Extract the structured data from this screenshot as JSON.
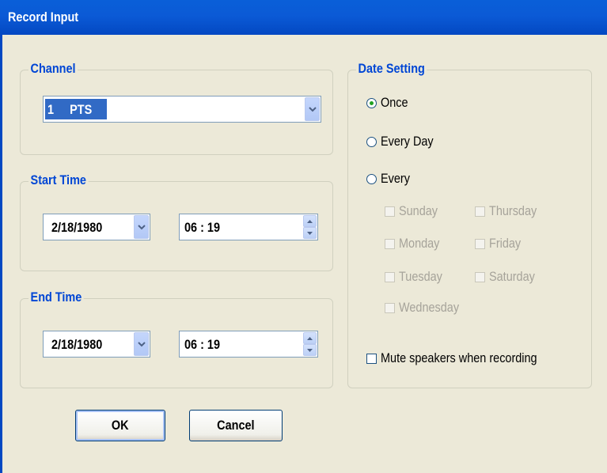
{
  "window": {
    "title": "Record Input"
  },
  "channel": {
    "legend": "Channel",
    "value": "1     PTS"
  },
  "start_time": {
    "legend": "Start Time",
    "date": "2/18/1980",
    "time": "06 : 19"
  },
  "end_time": {
    "legend": "End Time",
    "date": "2/18/1980",
    "time": "06 : 19"
  },
  "date_setting": {
    "legend": "Date Setting",
    "selected": "Once",
    "options": [
      "Once",
      "Every Day",
      "Every"
    ],
    "days": [
      "Sunday",
      "Monday",
      "Tuesday",
      "Wednesday",
      "Thursday",
      "Friday",
      "Saturday"
    ],
    "mute_label": "Mute speakers when recording"
  },
  "buttons": {
    "ok": "OK",
    "cancel": "Cancel"
  },
  "colors": {
    "titlebar": "#0348c2",
    "legend": "#0046d5",
    "selection": "#316ac5",
    "radio_dot": "#21a121"
  },
  "icons": [
    "chevron-down-icon",
    "spin-up-icon",
    "spin-down-icon"
  ]
}
